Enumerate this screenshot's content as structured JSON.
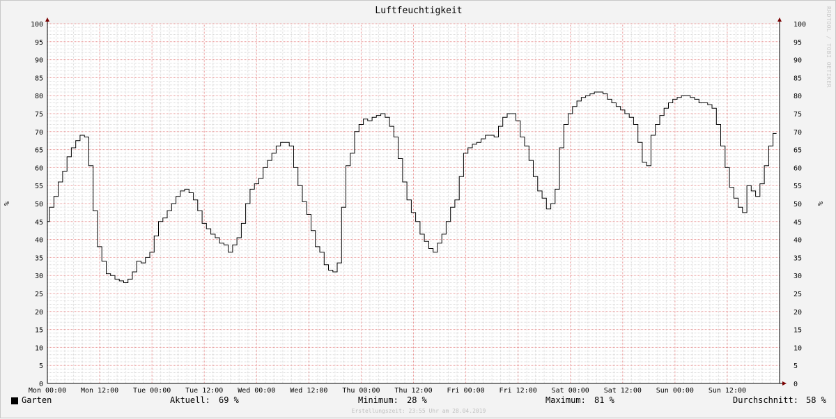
{
  "chart_data": {
    "type": "line",
    "title": "Luftfeuchtigkeit",
    "ylabel": "%",
    "ylim": [
      0,
      100
    ],
    "y_ticks": [
      0,
      5,
      10,
      15,
      20,
      25,
      30,
      35,
      40,
      45,
      50,
      55,
      60,
      65,
      70,
      75,
      80,
      85,
      90,
      95,
      100
    ],
    "x_ticks": [
      "Mon 00:00",
      "Mon 12:00",
      "Tue 00:00",
      "Tue 12:00",
      "Wed 00:00",
      "Wed 12:00",
      "Thu 00:00",
      "Thu 12:00",
      "Fri 00:00",
      "Fri 12:00",
      "Sat 00:00",
      "Sat 12:00",
      "Sun 00:00",
      "Sun 12:00"
    ],
    "x_range_hours": [
      0,
      168
    ],
    "step": true,
    "series": [
      {
        "name": "Garten",
        "color": "#000000",
        "points": [
          [
            0.0,
            45
          ],
          [
            0.5,
            49
          ],
          [
            1.5,
            52
          ],
          [
            2.5,
            56
          ],
          [
            3.5,
            59
          ],
          [
            4.5,
            63
          ],
          [
            5.5,
            65.5
          ],
          [
            6.5,
            67.5
          ],
          [
            7.5,
            69
          ],
          [
            8.5,
            68.5
          ],
          [
            9.5,
            60.5
          ],
          [
            10.5,
            48
          ],
          [
            11.5,
            38
          ],
          [
            12.5,
            34
          ],
          [
            13.5,
            30.5
          ],
          [
            14.5,
            30
          ],
          [
            15.5,
            29
          ],
          [
            16.5,
            28.5
          ],
          [
            17.5,
            28
          ],
          [
            18.5,
            29
          ],
          [
            19.5,
            31
          ],
          [
            20.5,
            34
          ],
          [
            21.5,
            33.5
          ],
          [
            22.5,
            35
          ],
          [
            23.5,
            36.5
          ],
          [
            24.5,
            41
          ],
          [
            25.5,
            45
          ],
          [
            26.5,
            46
          ],
          [
            27.5,
            48
          ],
          [
            28.5,
            50
          ],
          [
            29.5,
            52
          ],
          [
            30.5,
            53.5
          ],
          [
            31.5,
            54
          ],
          [
            32.5,
            53
          ],
          [
            33.5,
            51
          ],
          [
            34.5,
            48
          ],
          [
            35.5,
            44.5
          ],
          [
            36.5,
            43
          ],
          [
            37.5,
            41.5
          ],
          [
            38.5,
            40.5
          ],
          [
            39.5,
            39
          ],
          [
            40.5,
            38.5
          ],
          [
            41.5,
            36.5
          ],
          [
            42.5,
            38.5
          ],
          [
            43.5,
            40.5
          ],
          [
            44.5,
            44.5
          ],
          [
            45.5,
            50
          ],
          [
            46.5,
            54
          ],
          [
            47.5,
            55.5
          ],
          [
            48.5,
            57
          ],
          [
            49.5,
            60
          ],
          [
            50.5,
            62
          ],
          [
            51.5,
            64
          ],
          [
            52.5,
            66
          ],
          [
            53.5,
            67
          ],
          [
            54.5,
            67
          ],
          [
            55.5,
            66
          ],
          [
            56.5,
            60
          ],
          [
            57.5,
            55
          ],
          [
            58.5,
            50.5
          ],
          [
            59.5,
            47
          ],
          [
            60.5,
            42.5
          ],
          [
            61.5,
            38
          ],
          [
            62.5,
            36.5
          ],
          [
            63.5,
            33
          ],
          [
            64.5,
            31.5
          ],
          [
            65.5,
            31
          ],
          [
            66.5,
            33.5
          ],
          [
            67.5,
            49
          ],
          [
            68.5,
            60.5
          ],
          [
            69.5,
            64
          ],
          [
            70.5,
            70
          ],
          [
            71.5,
            72
          ],
          [
            72.5,
            73.5
          ],
          [
            73.5,
            73
          ],
          [
            74.5,
            74
          ],
          [
            75.5,
            74.5
          ],
          [
            76.5,
            75
          ],
          [
            77.5,
            74
          ],
          [
            78.5,
            71.5
          ],
          [
            79.5,
            68.5
          ],
          [
            80.5,
            62.5
          ],
          [
            81.5,
            56
          ],
          [
            82.5,
            51
          ],
          [
            83.5,
            47.5
          ],
          [
            84.5,
            45
          ],
          [
            85.5,
            41.5
          ],
          [
            86.5,
            39.5
          ],
          [
            87.5,
            37.5
          ],
          [
            88.5,
            36.5
          ],
          [
            89.5,
            39
          ],
          [
            90.5,
            41.5
          ],
          [
            91.5,
            45
          ],
          [
            92.5,
            49
          ],
          [
            93.5,
            51
          ],
          [
            94.5,
            57.5
          ],
          [
            95.5,
            64
          ],
          [
            96.5,
            65.5
          ],
          [
            97.5,
            66.5
          ],
          [
            98.5,
            67
          ],
          [
            99.5,
            68
          ],
          [
            100.5,
            69
          ],
          [
            101.5,
            69
          ],
          [
            102.5,
            68.5
          ],
          [
            103.5,
            71.5
          ],
          [
            104.5,
            74
          ],
          [
            105.5,
            75
          ],
          [
            106.5,
            75
          ],
          [
            107.5,
            73
          ],
          [
            108.5,
            68.5
          ],
          [
            109.5,
            66
          ],
          [
            110.5,
            62
          ],
          [
            111.5,
            57.5
          ],
          [
            112.5,
            53.5
          ],
          [
            113.5,
            51.5
          ],
          [
            114.5,
            48.5
          ],
          [
            115.5,
            50
          ],
          [
            116.5,
            54
          ],
          [
            117.5,
            65.5
          ],
          [
            118.5,
            72
          ],
          [
            119.5,
            75
          ],
          [
            120.5,
            77
          ],
          [
            121.5,
            78.5
          ],
          [
            122.5,
            79.5
          ],
          [
            123.5,
            80
          ],
          [
            124.5,
            80.5
          ],
          [
            125.5,
            81
          ],
          [
            126.5,
            81
          ],
          [
            127.5,
            80.5
          ],
          [
            128.5,
            79
          ],
          [
            129.5,
            78
          ],
          [
            130.5,
            77
          ],
          [
            131.5,
            76
          ],
          [
            132.5,
            75
          ],
          [
            133.5,
            74
          ],
          [
            134.5,
            72
          ],
          [
            135.5,
            67
          ],
          [
            136.5,
            61.5
          ],
          [
            137.5,
            60.5
          ],
          [
            138.5,
            69
          ],
          [
            139.5,
            72
          ],
          [
            140.5,
            74.5
          ],
          [
            141.5,
            76.5
          ],
          [
            142.5,
            78
          ],
          [
            143.5,
            79
          ],
          [
            144.5,
            79.5
          ],
          [
            145.5,
            80
          ],
          [
            146.5,
            80
          ],
          [
            147.5,
            79.5
          ],
          [
            148.5,
            79
          ],
          [
            149.5,
            78
          ],
          [
            150.5,
            78
          ],
          [
            151.5,
            77.5
          ],
          [
            152.5,
            76.5
          ],
          [
            153.5,
            72
          ],
          [
            154.5,
            66
          ],
          [
            155.5,
            60
          ],
          [
            156.5,
            54.5
          ],
          [
            157.5,
            51.5
          ],
          [
            158.5,
            49
          ],
          [
            159.5,
            47.5
          ],
          [
            160.5,
            55
          ],
          [
            161.5,
            53.5
          ],
          [
            162.5,
            52
          ],
          [
            163.5,
            55.5
          ],
          [
            164.5,
            60.5
          ],
          [
            165.5,
            66
          ],
          [
            166.5,
            69.5
          ],
          [
            167.3,
            69.5
          ]
        ]
      }
    ]
  },
  "legend": {
    "series_name": "Garten",
    "aktuell_label": "Aktuell:",
    "aktuell_value": "69 %",
    "minimum_label": "Minimum:",
    "minimum_value": "28 %",
    "maximum_label": "Maximum:",
    "maximum_value": "81 %",
    "durchschnitt_label": "Durchschnitt:",
    "durchschnitt_value": "58 %"
  },
  "footer": "Erstellungszeit: 23:55 Uhr am 28.04.2019",
  "side_credit": "RRDTOOL / TOBI OETIKER",
  "colors": {
    "background": "#f3f3f3",
    "canvas": "#ffffff",
    "minor_grid": "#dcdcdc",
    "major_grid": "#e89494",
    "axis_arrow": "#7a0000",
    "line": "#000000"
  }
}
